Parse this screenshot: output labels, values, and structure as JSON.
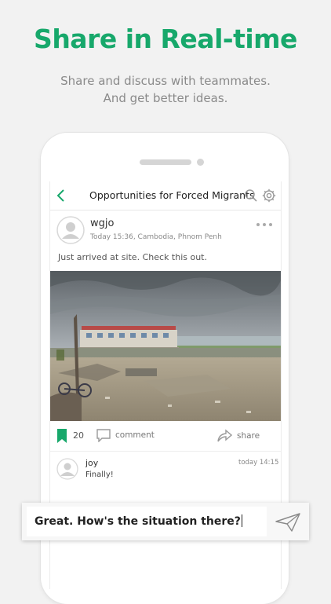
{
  "headline": "Share in Real-time",
  "subtitle_line1": "Share and discuss with teammates.",
  "subtitle_line2": "And get better ideas.",
  "colors": {
    "accent": "#17a86b",
    "icon_gray": "#9a9a9a"
  },
  "topbar": {
    "title": "Opportunities for Forced Migrants",
    "icons": [
      "back-icon",
      "search-icon",
      "gear-icon"
    ]
  },
  "post": {
    "author": "wgjo",
    "meta": "Today 15:36, Cambodia, Phnom Penh",
    "text": "Just arrived at site. Check this out.",
    "bookmark_count": "20",
    "comment_label": "comment",
    "share_label": "share"
  },
  "comment": {
    "author": "joy",
    "text": "Finally!",
    "time": "today 14:15"
  },
  "composer": {
    "value": "Great. How's the situation there?"
  }
}
